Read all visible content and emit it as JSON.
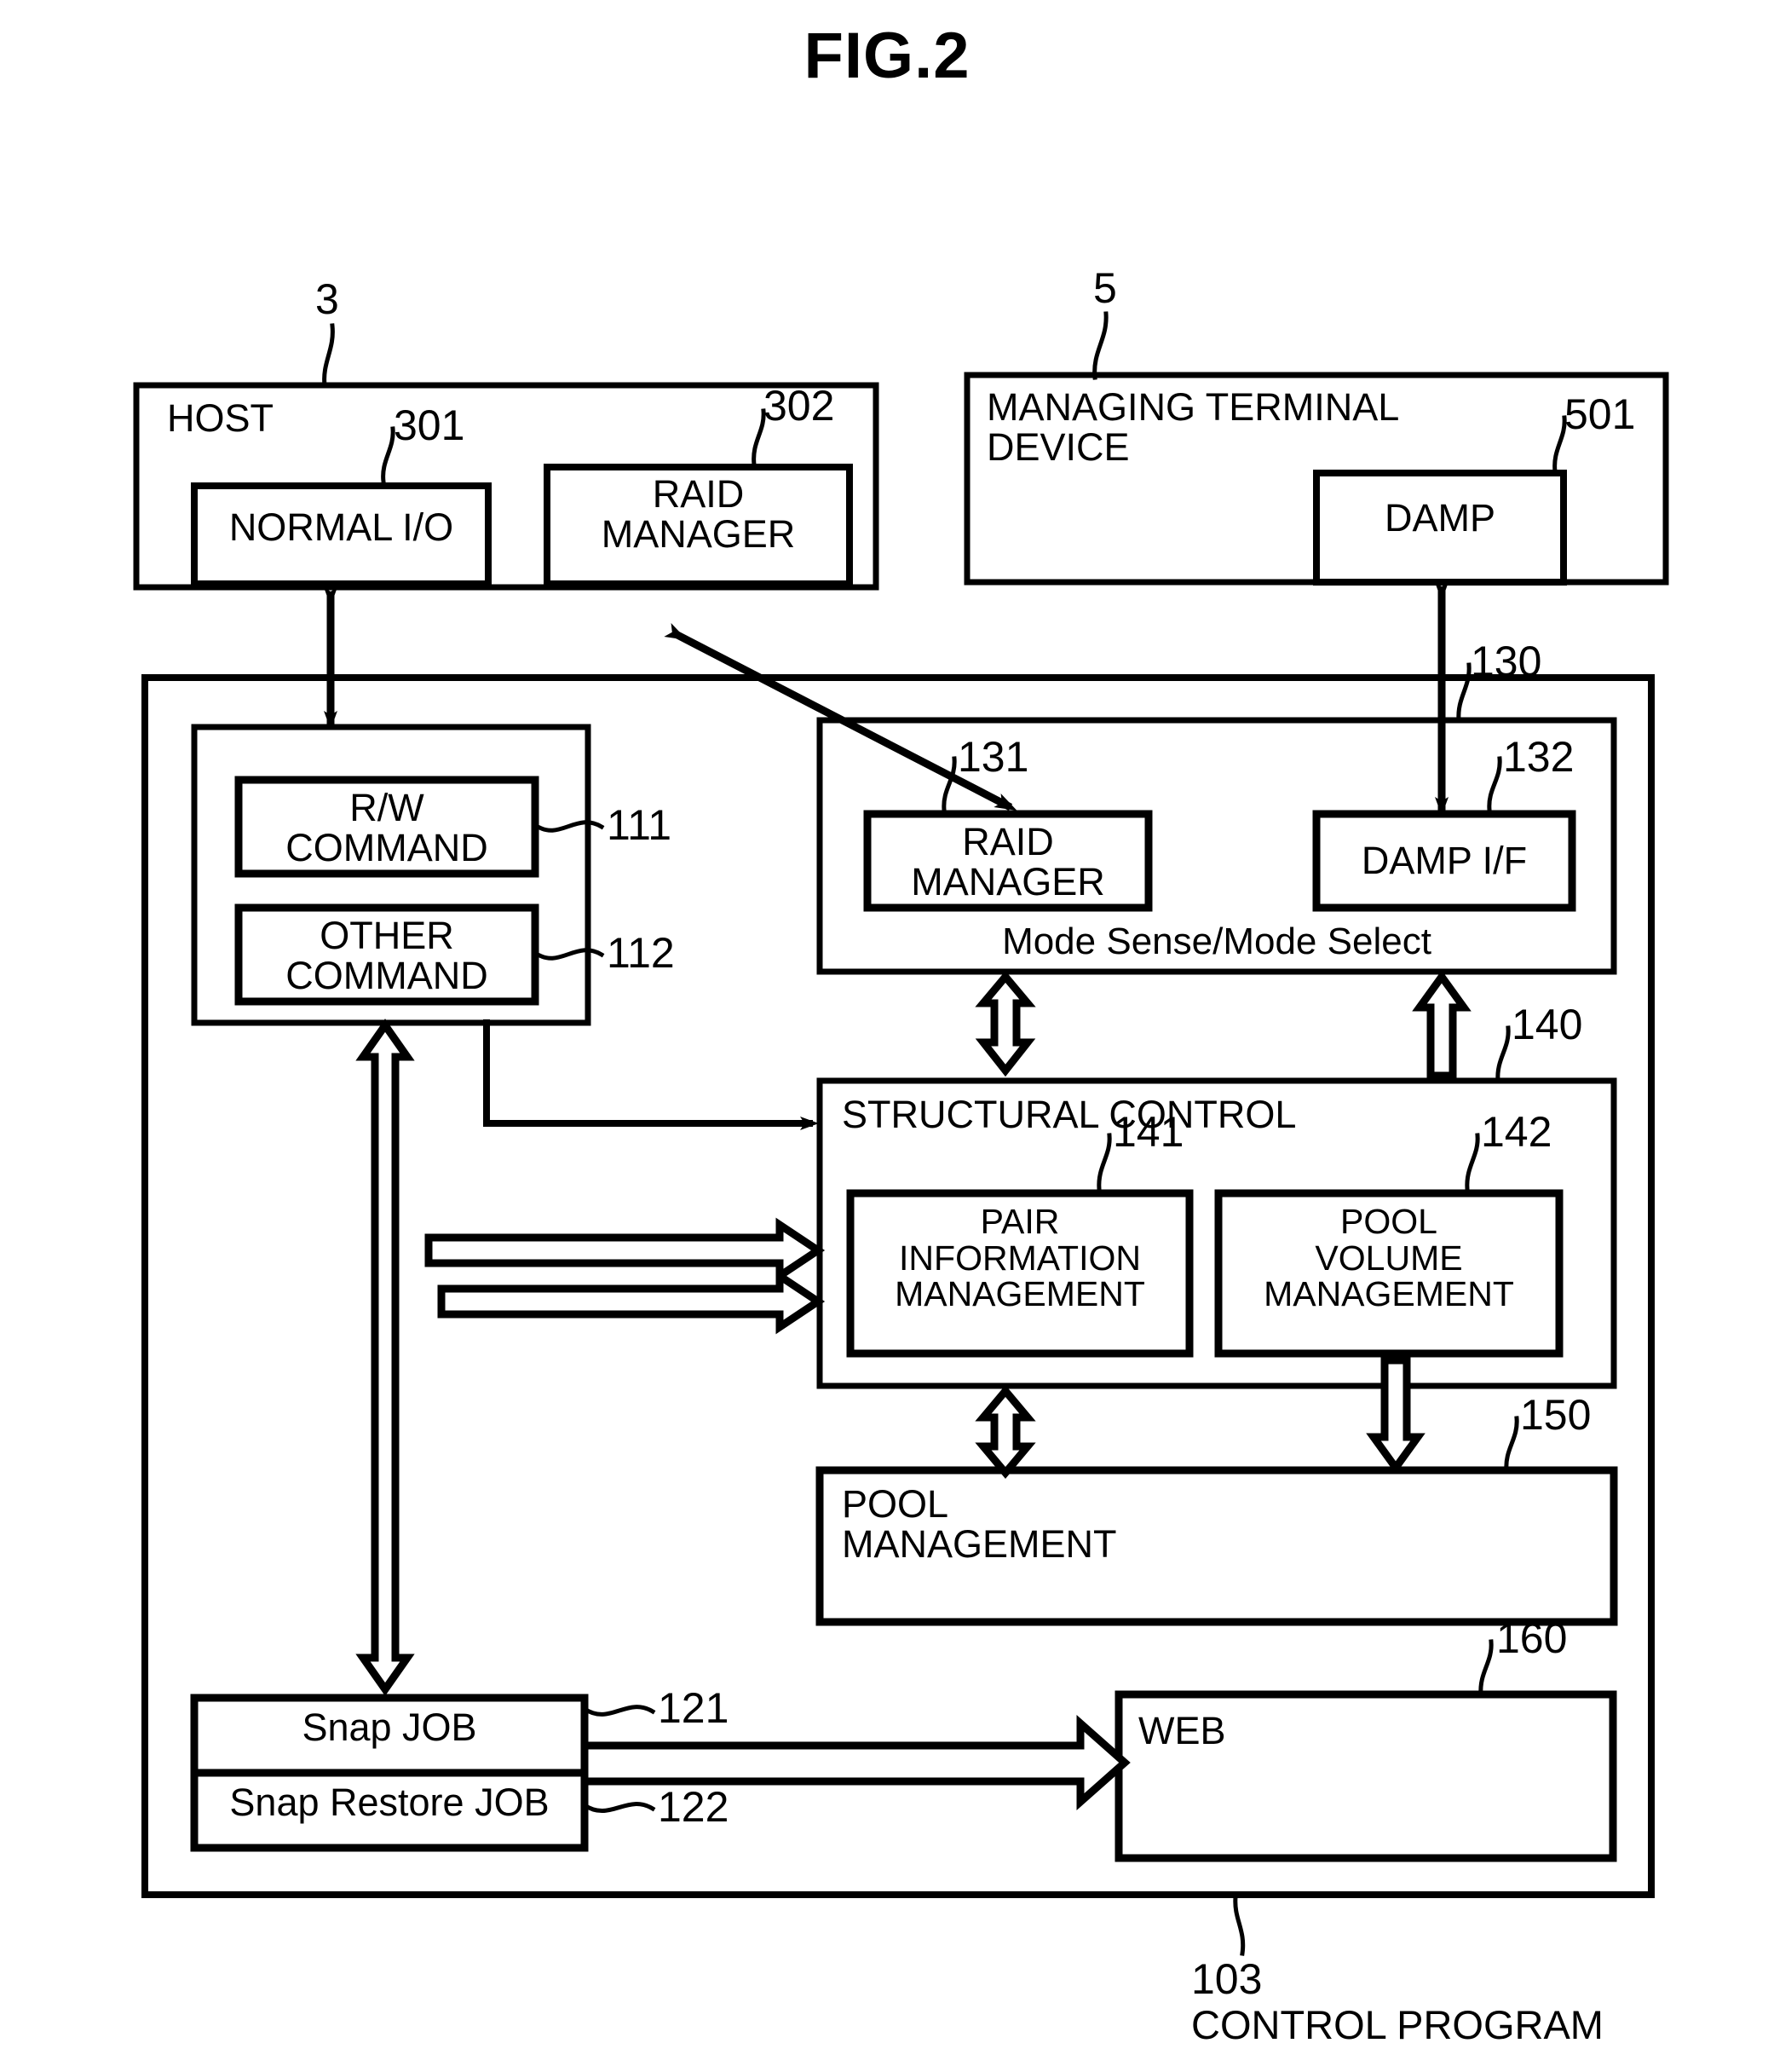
{
  "figure": {
    "title": "FIG.2",
    "bottom_label": "CONTROL PROGRAM",
    "bottom_ref": "103"
  },
  "refs": {
    "host": "3",
    "normal_io": "301",
    "raid_manager_host": "302",
    "managing_terminal": "5",
    "damp": "501",
    "rw_command": "111",
    "other_command": "112",
    "snap_job": "121",
    "snap_restore_job": "122",
    "interface_group": "130",
    "raid_manager_ctl": "131",
    "damp_if": "132",
    "structural_control": "140",
    "pair_info_mgmt": "141",
    "pool_volume_mgmt": "142",
    "pool_management": "150",
    "web": "160"
  },
  "blocks": {
    "host": {
      "title": "HOST",
      "children": [
        {
          "label": "NORMAL I/O"
        },
        {
          "label": "RAID\nMANAGER"
        }
      ]
    },
    "managing_terminal": {
      "title": "MANAGING TERMINAL\nDEVICE",
      "children": [
        {
          "label": "DAMP"
        }
      ]
    },
    "command_group": {
      "children": [
        {
          "label": "R/W\nCOMMAND"
        },
        {
          "label": "OTHER\nCOMMAND"
        }
      ]
    },
    "interface_group": {
      "footer": "Mode Sense/Mode Select",
      "children": [
        {
          "label": "RAID\nMANAGER"
        },
        {
          "label": "DAMP I/F"
        }
      ]
    },
    "structural_control": {
      "title": "STRUCTURAL CONTROL",
      "children": [
        {
          "label": "PAIR\nINFORMATION\nMANAGEMENT"
        },
        {
          "label": "POOL\nVOLUME\nMANAGEMENT"
        }
      ]
    },
    "pool_management": {
      "title": "POOL\nMANAGEMENT"
    },
    "jobs": {
      "children": [
        {
          "label": "Snap JOB"
        },
        {
          "label": "Snap Restore JOB"
        }
      ]
    },
    "web": {
      "title": "WEB"
    }
  },
  "colors": {
    "ink": "#000000",
    "paper": "#ffffff"
  }
}
